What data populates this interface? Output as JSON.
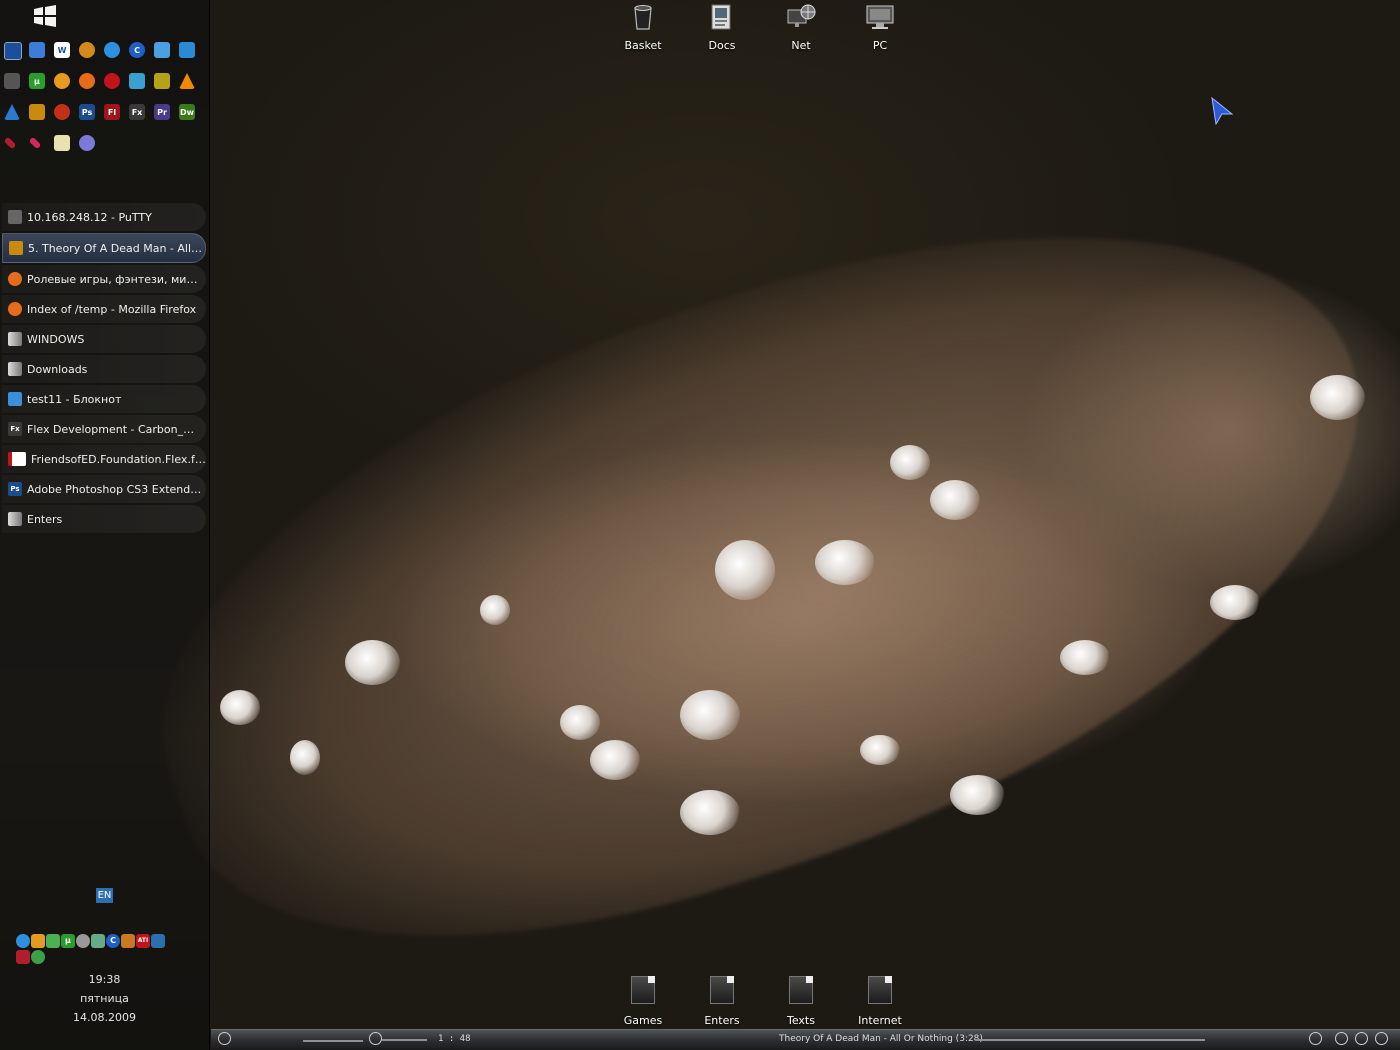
{
  "desktop_icons_top": [
    {
      "name": "basket-icon",
      "label": "Basket"
    },
    {
      "name": "docs-icon",
      "label": "Docs"
    },
    {
      "name": "net-icon",
      "label": "Net"
    },
    {
      "name": "pc-icon",
      "label": "PC"
    }
  ],
  "desktop_icons_bottom": [
    {
      "name": "games-folder-icon",
      "label": "Games"
    },
    {
      "name": "enters-folder-icon",
      "label": "Enters"
    },
    {
      "name": "texts-folder-icon",
      "label": "Texts"
    },
    {
      "name": "internet-folder-icon",
      "label": "Internet"
    }
  ],
  "quicklaunch": {
    "labels": {
      "word": "W",
      "utorrent": "µ",
      "photoshop": "Ps",
      "flash": "Fl",
      "flex": "Fx",
      "premiere": "Pr",
      "dreamweaver": "Dw",
      "ccleaner": "C"
    }
  },
  "taskbar": {
    "items": [
      {
        "label": "10.168.248.12 - PuTTY",
        "icon": "putty-icon"
      },
      {
        "label": "5. Theory Of A Dead Man - All O...",
        "icon": "aimp-icon",
        "active": true
      },
      {
        "label": "Ролевые игры, фэнтези, мифо...",
        "icon": "firefox-icon"
      },
      {
        "label": "Index of /temp - Mozilla Firefox",
        "icon": "firefox-icon"
      },
      {
        "label": "WINDOWS",
        "icon": "folder-icon"
      },
      {
        "label": "Downloads",
        "icon": "folder-icon"
      },
      {
        "label": "test11 - Блокнот",
        "icon": "notepad-icon"
      },
      {
        "label": "Flex Development - Carbon_mai...",
        "icon": "flex-icon",
        "icon_text": "Fx"
      },
      {
        "label": "FriendsofED.Foundation.Flex.fo...",
        "icon": "pdf-icon"
      },
      {
        "label": "Adobe Photoshop CS3 Extende...",
        "icon": "photoshop-icon",
        "icon_text": "Ps"
      },
      {
        "label": "Enters",
        "icon": "folder-icon"
      }
    ]
  },
  "language": "EN",
  "tray_labels": {
    "utorrent": "µ",
    "ccleaner": "C",
    "ati": "ATI"
  },
  "clock": {
    "time": "19:38",
    "day": "пятница",
    "date": "14.08.2009"
  },
  "media_player": {
    "elapsed": "1 : 48",
    "track": "Theory Of A Dead Man - All Or Nothing (3:28)"
  },
  "colors": {
    "accent": "#2b6fb2",
    "active_task": "#3b5270",
    "cursor": "#2d5bd8"
  }
}
